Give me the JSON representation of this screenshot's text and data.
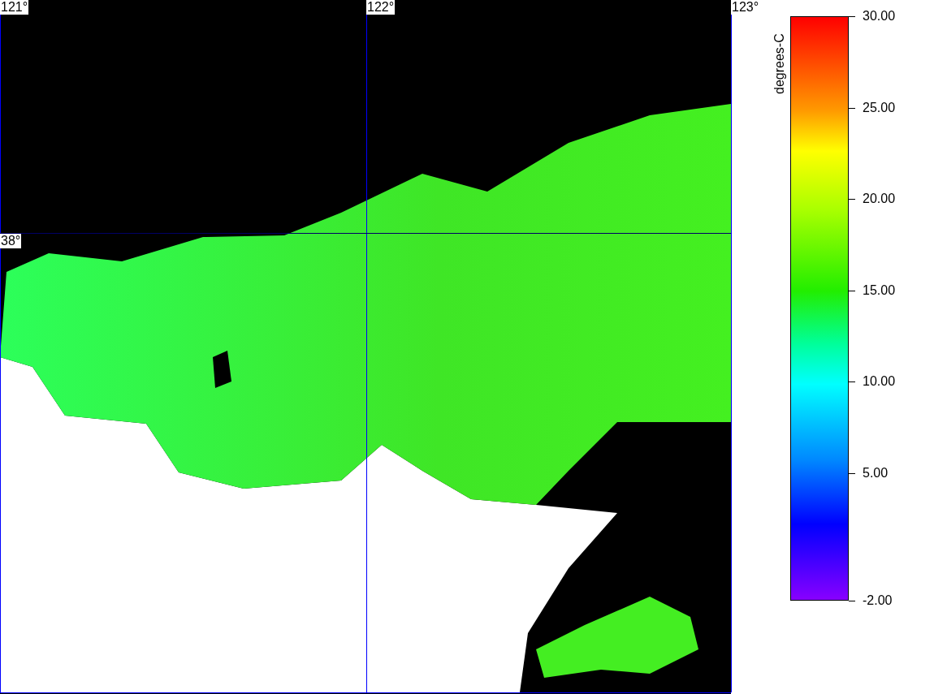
{
  "map": {
    "longitude_labels": [
      "121°",
      "122°",
      "123°"
    ],
    "latitude_labels": [
      "38°"
    ]
  },
  "colorbar": {
    "unit": "degrees-C",
    "ticks": [
      "30.00",
      "25.00",
      "20.00",
      "15.00",
      "10.00",
      "5.00",
      "-2.00"
    ]
  }
}
